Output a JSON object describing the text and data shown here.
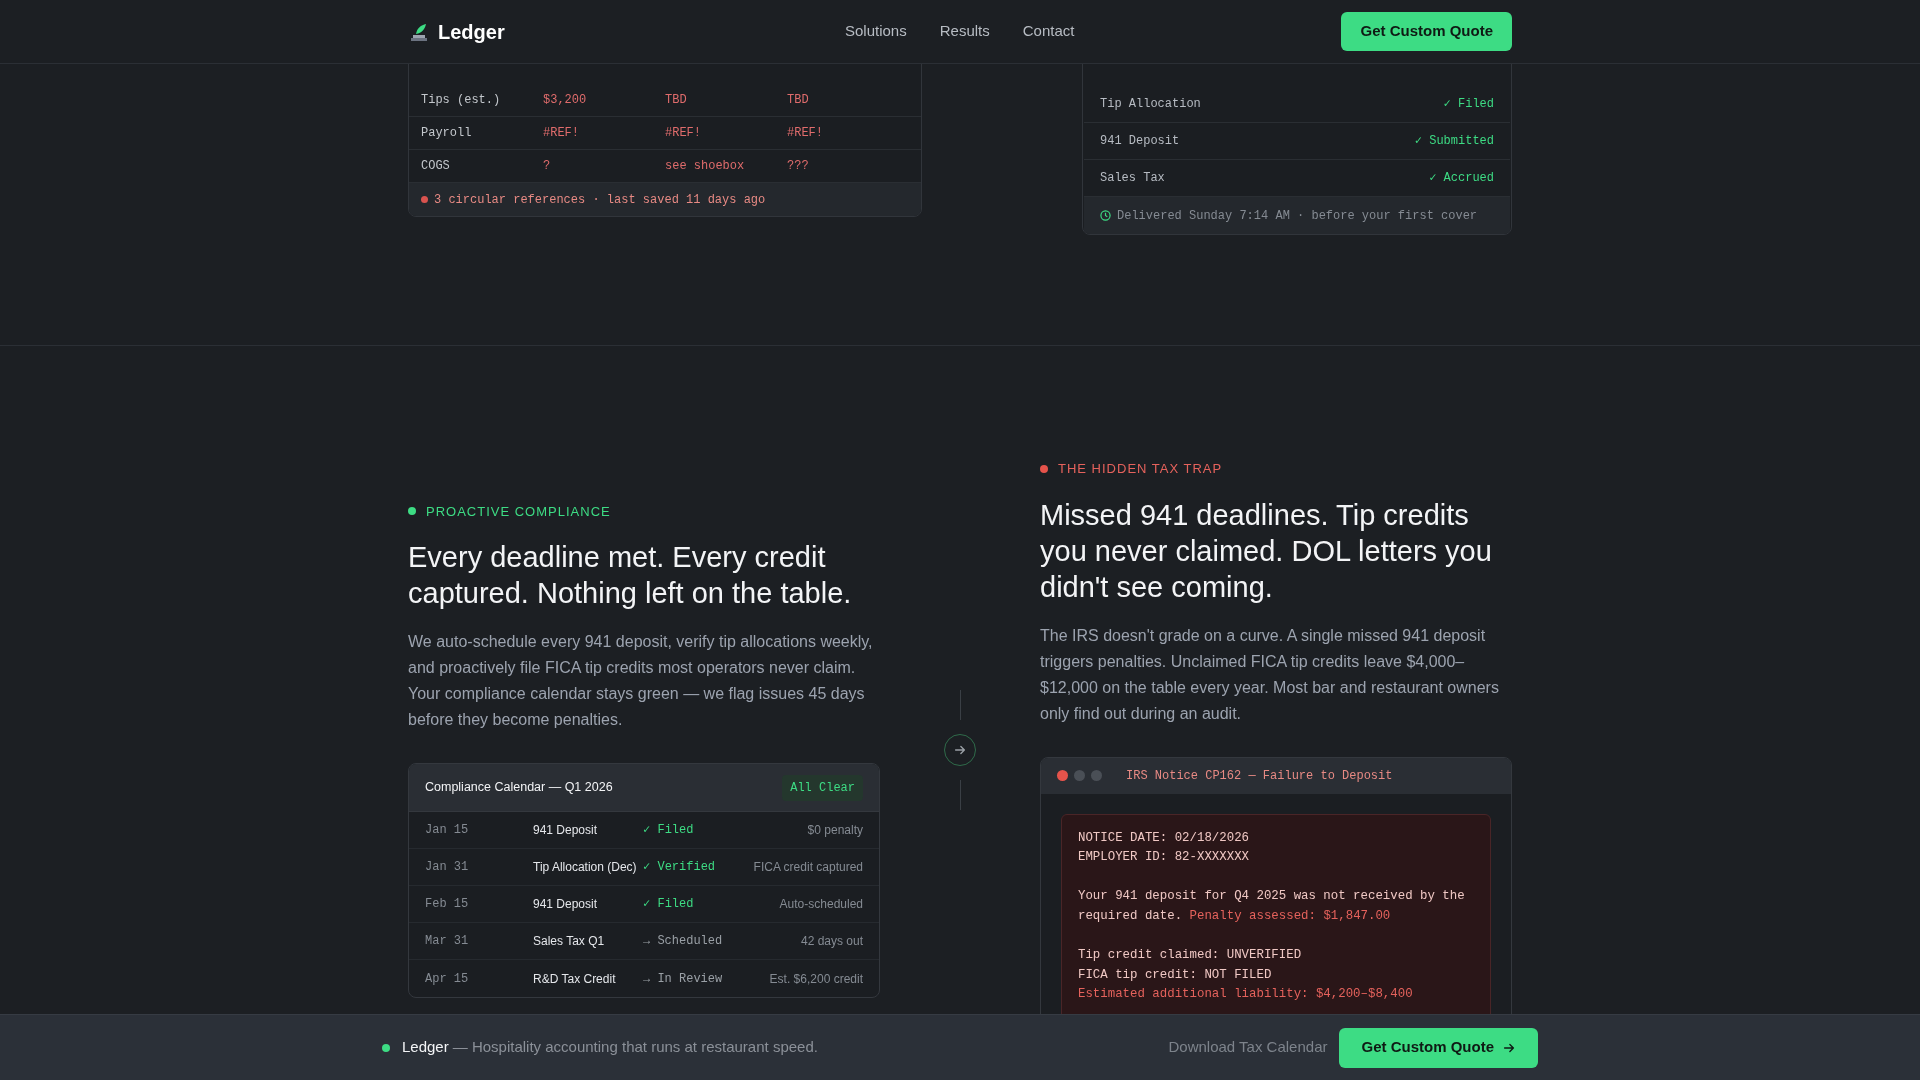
{
  "header": {
    "brand": "Ledger",
    "nav": [
      {
        "label": "Solutions"
      },
      {
        "label": "Results"
      },
      {
        "label": "Contact"
      }
    ],
    "cta": "Get Custom Quote"
  },
  "spreadsheet": {
    "rows": [
      {
        "cells": [
          "Tips (est.)",
          "$3,200",
          "TBD",
          "TBD"
        ]
      },
      {
        "cells": [
          "Payroll",
          "#REF!",
          "#REF!",
          "#REF!"
        ]
      },
      {
        "cells": [
          "COGS",
          "?",
          "see shoebox",
          "???"
        ]
      }
    ],
    "footer": "3 circular references · last saved 11 days ago"
  },
  "report": {
    "rows": [
      {
        "label": "Tip Allocation",
        "status": "✓ Filed"
      },
      {
        "label": "941 Deposit",
        "status": "✓ Submitted"
      },
      {
        "label": "Sales Tax",
        "status": "✓ Accrued"
      }
    ],
    "footer": "Delivered Sunday 7:14 AM · before your first cover"
  },
  "compliance": {
    "eyebrow": "PROACTIVE COMPLIANCE",
    "heading": "Every deadline met. Every credit captured. Nothing left on the table.",
    "body": "We auto-schedule every 941 deposit, verify tip allocations weekly, and proactively file FICA tip credits most operators never claim. Your compliance calendar stays green — we flag issues 45 days before they become penalties.",
    "calendar": {
      "title": "Compliance Calendar — Q1 2026",
      "badge": "All Clear",
      "rows": [
        {
          "date": "Jan 15",
          "item": "941 Deposit",
          "status": "✓ Filed",
          "kind": "done",
          "note": "$0 penalty"
        },
        {
          "date": "Jan 31",
          "item": "Tip Allocation (Dec)",
          "status": "✓ Verified",
          "kind": "done",
          "note": "FICA credit captured"
        },
        {
          "date": "Feb 15",
          "item": "941 Deposit",
          "status": "✓ Filed",
          "kind": "done",
          "note": "Auto-scheduled"
        },
        {
          "date": "Mar 31",
          "item": "Sales Tax Q1",
          "status": "→ Scheduled",
          "kind": "pending",
          "note": "42 days out"
        },
        {
          "date": "Apr 15",
          "item": "R&D Tax Credit",
          "status": "→ In Review",
          "kind": "pending",
          "note": "Est. $6,200 credit"
        }
      ]
    }
  },
  "trap": {
    "eyebrow": "THE HIDDEN TAX TRAP",
    "heading": "Missed 941 deadlines. Tip credits you never claimed. DOL letters you didn't see coming.",
    "body": "The IRS doesn't grade on a curve. A single missed 941 deposit triggers penalties. Unclaimed FICA tip credits leave $4,000–$12,000 on the table every year. Most bar and restaurant owners only find out during an audit.",
    "notice": {
      "title": "IRS Notice CP162 — Failure to Deposit",
      "groups": [
        [
          {
            "parts": [
              {
                "text": "NOTICE DATE: 02/18/2026",
                "kind": "plain"
              }
            ]
          },
          {
            "parts": [
              {
                "text": "EMPLOYER ID: 82-XXXXXXX",
                "kind": "plain"
              }
            ]
          }
        ],
        [
          {
            "parts": [
              {
                "text": "Your 941 deposit for Q4 2025 was not received by the required date.",
                "kind": "plain"
              },
              {
                "text": "Penalty assessed: $1,847.00",
                "kind": "alert"
              }
            ]
          }
        ],
        [
          {
            "parts": [
              {
                "text": "Tip credit claimed: UNVERIFIED",
                "kind": "plain"
              }
            ]
          },
          {
            "parts": [
              {
                "text": "FICA tip credit: NOT FILED",
                "kind": "plain"
              }
            ]
          },
          {
            "parts": [
              {
                "text": "Estimated additional liability: $4,200–$8,400",
                "kind": "alert"
              }
            ]
          }
        ]
      ]
    }
  },
  "footer": {
    "brand": "Ledger",
    "tagline": "— Hospitality accounting that runs at restaurant speed.",
    "link": "Download Tax Calendar",
    "cta": "Get Custom Quote"
  }
}
